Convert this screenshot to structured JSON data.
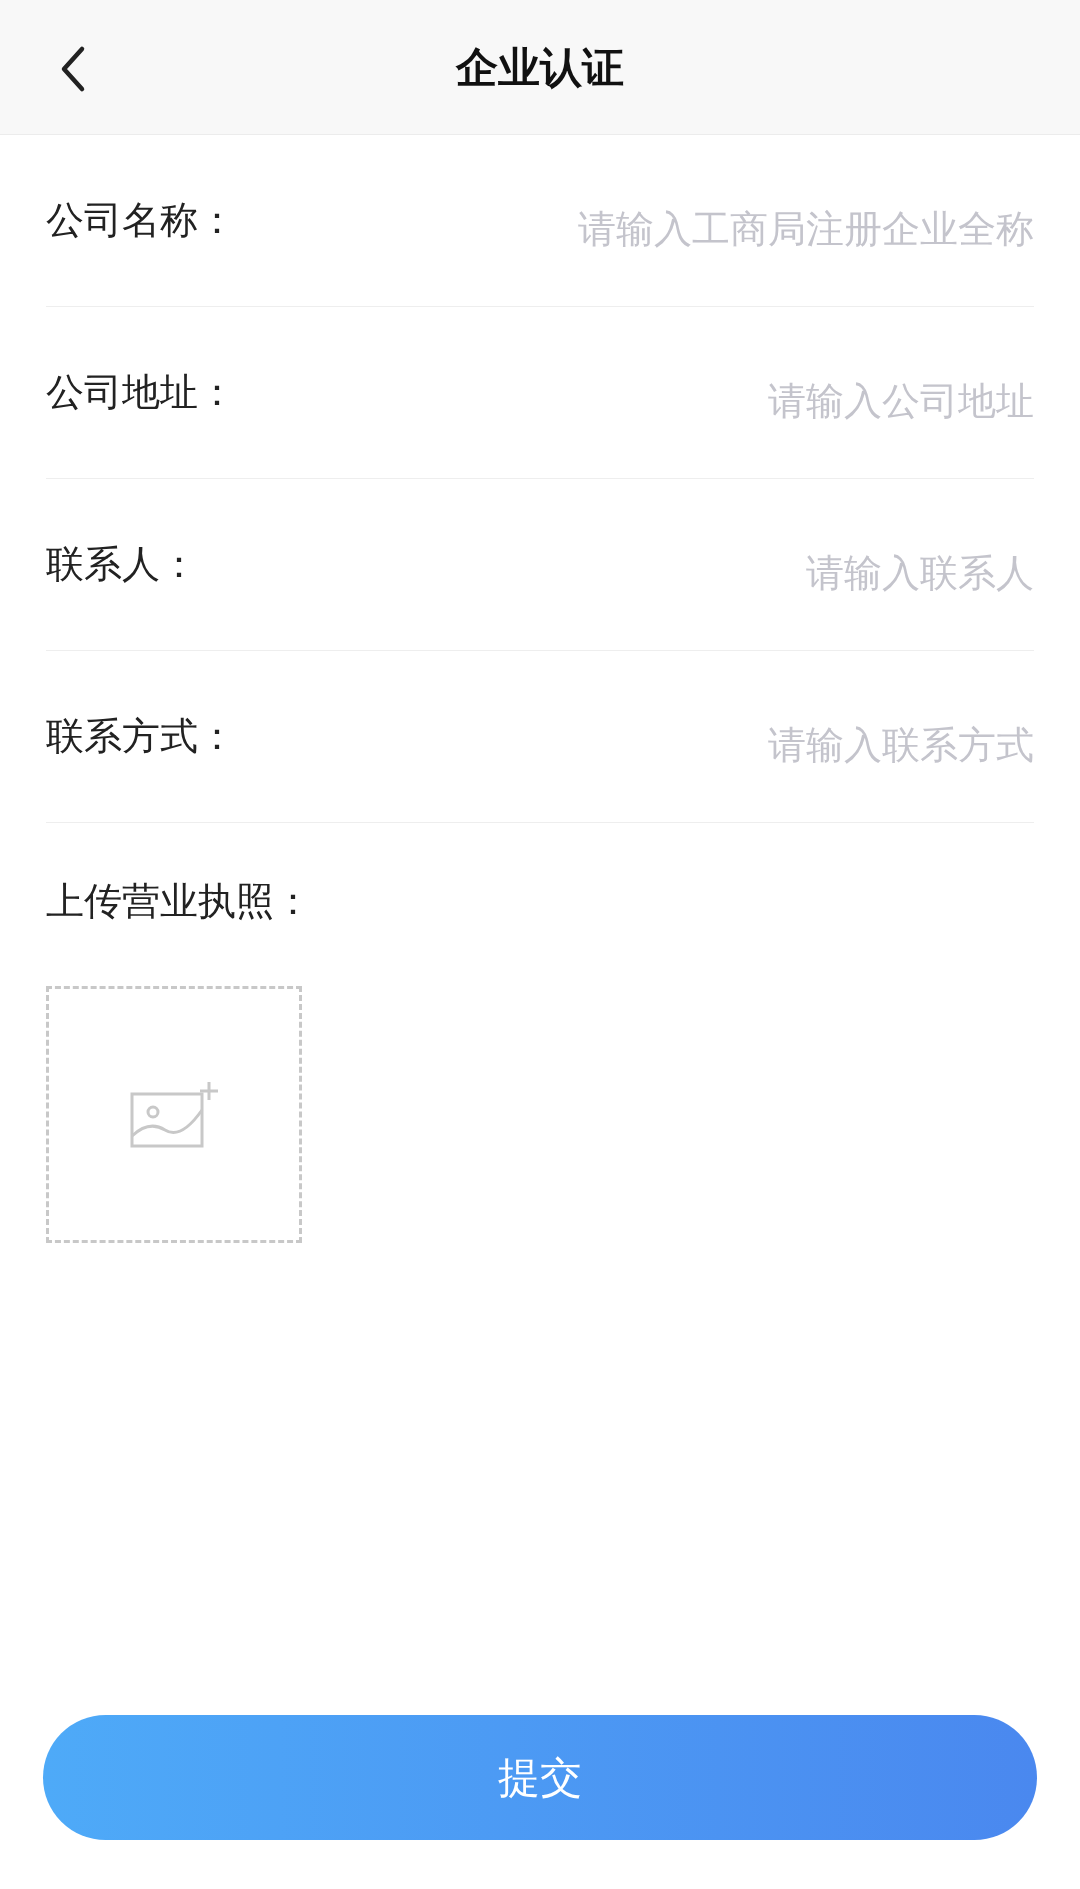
{
  "header": {
    "title": "企业认证"
  },
  "fields": [
    {
      "label": "公司名称：",
      "placeholder": "请输入工商局注册企业全称"
    },
    {
      "label": "公司地址：",
      "placeholder": "请输入公司地址"
    },
    {
      "label": "联系人：",
      "placeholder": "请输入联系人"
    },
    {
      "label": "联系方式：",
      "placeholder": "请输入联系方式"
    }
  ],
  "upload": {
    "label": "上传营业执照："
  },
  "submit": "提交"
}
